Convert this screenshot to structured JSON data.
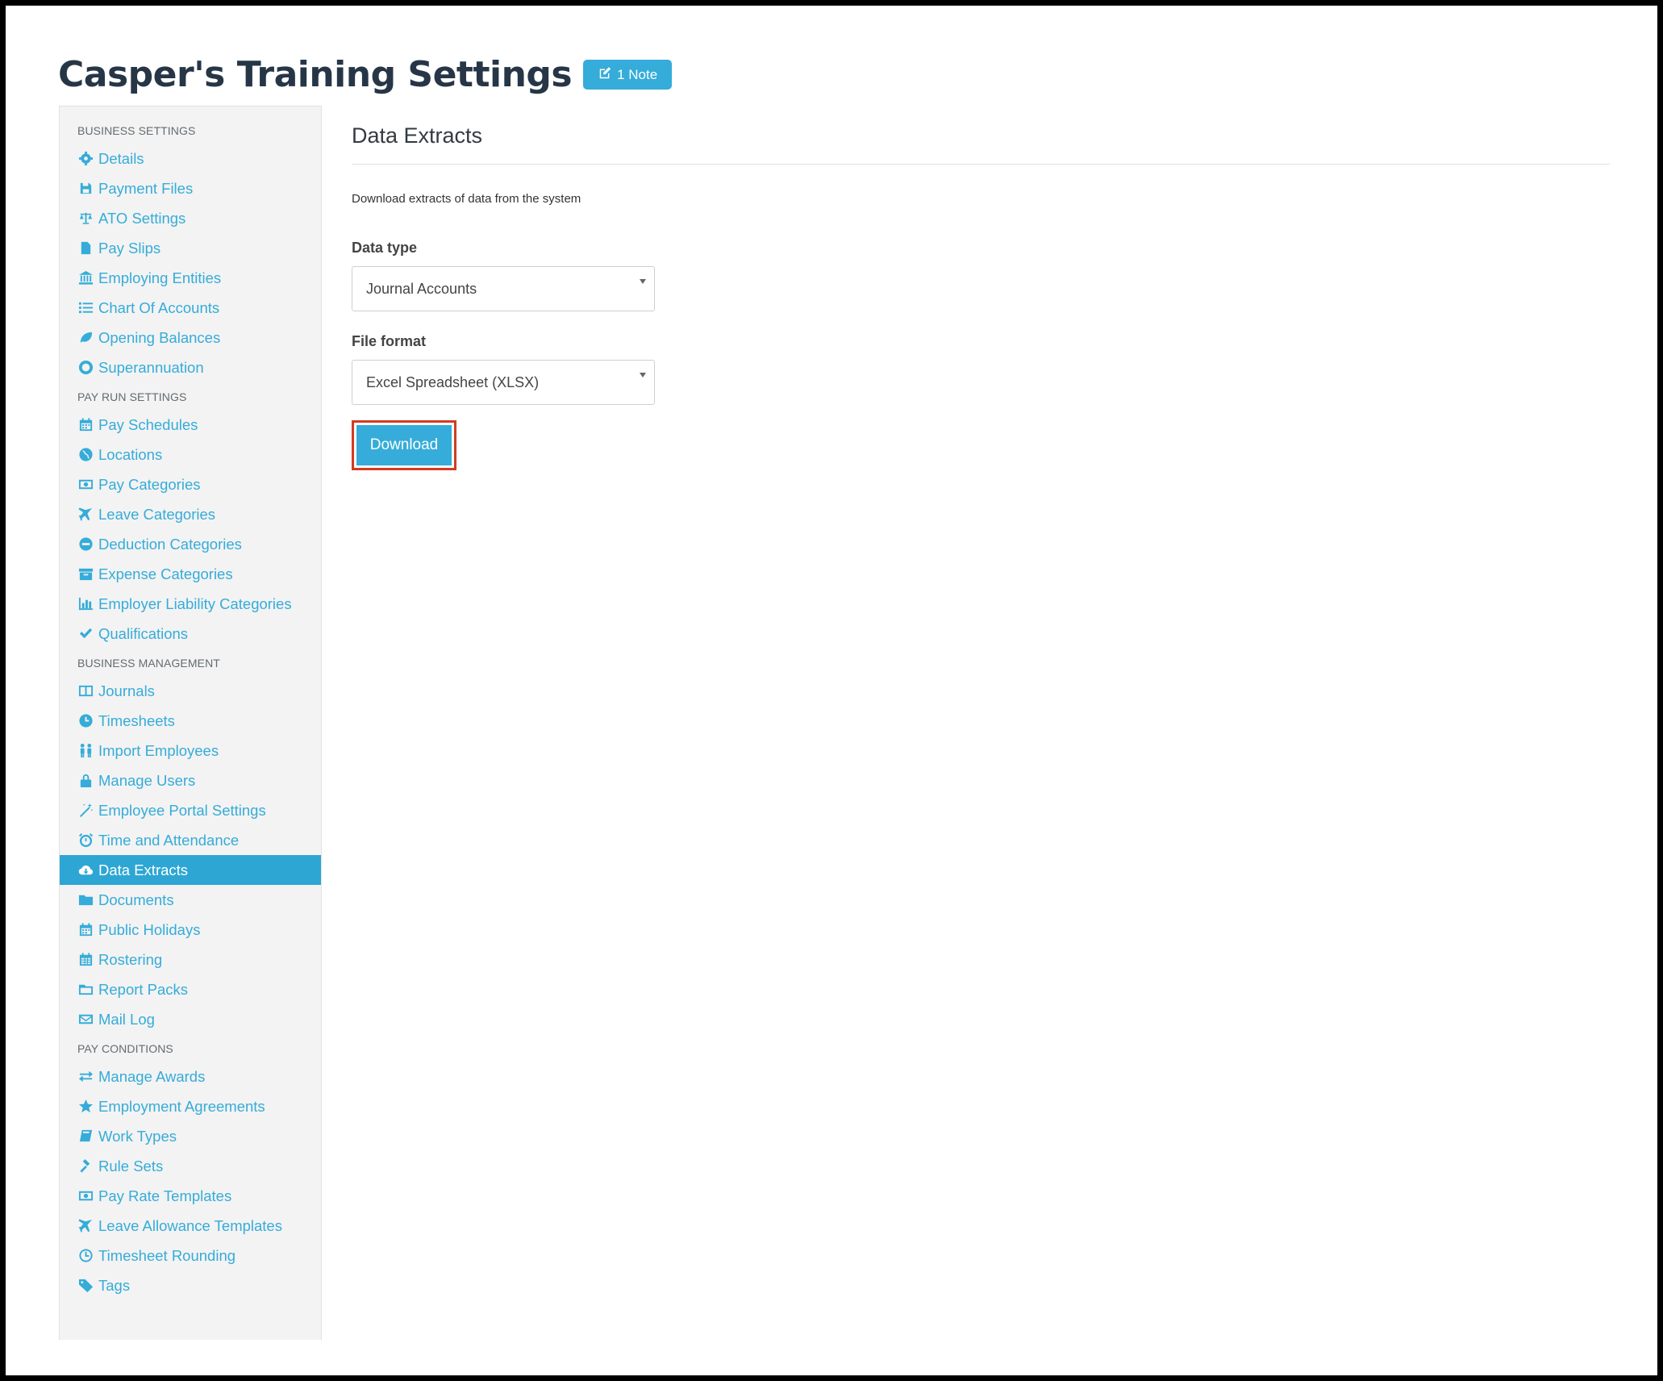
{
  "page": {
    "title": "Casper's Training Settings",
    "note_badge": "1 Note"
  },
  "sidebar": {
    "sections": [
      {
        "header": "BUSINESS SETTINGS",
        "items": [
          {
            "label": "Details",
            "icon": "gear-icon"
          },
          {
            "label": "Payment Files",
            "icon": "floppy-icon"
          },
          {
            "label": "ATO Settings",
            "icon": "scales-icon"
          },
          {
            "label": "Pay Slips",
            "icon": "file-icon"
          },
          {
            "label": "Employing Entities",
            "icon": "bank-icon"
          },
          {
            "label": "Chart Of Accounts",
            "icon": "list-icon"
          },
          {
            "label": "Opening Balances",
            "icon": "leaf-icon"
          },
          {
            "label": "Superannuation",
            "icon": "life-ring-icon"
          }
        ]
      },
      {
        "header": "PAY RUN SETTINGS",
        "items": [
          {
            "label": "Pay Schedules",
            "icon": "calendar-icon"
          },
          {
            "label": "Locations",
            "icon": "globe-icon"
          },
          {
            "label": "Pay Categories",
            "icon": "money-icon"
          },
          {
            "label": "Leave Categories",
            "icon": "plane-icon"
          },
          {
            "label": "Deduction Categories",
            "icon": "minus-circle-icon"
          },
          {
            "label": "Expense Categories",
            "icon": "archive-icon"
          },
          {
            "label": "Employer Liability Categories",
            "icon": "bar-chart-icon"
          },
          {
            "label": "Qualifications",
            "icon": "check-icon"
          }
        ]
      },
      {
        "header": "BUSINESS MANAGEMENT",
        "items": [
          {
            "label": "Journals",
            "icon": "columns-icon"
          },
          {
            "label": "Timesheets",
            "icon": "clock-icon"
          },
          {
            "label": "Import Employees",
            "icon": "users-icon"
          },
          {
            "label": "Manage Users",
            "icon": "lock-icon"
          },
          {
            "label": "Employee Portal Settings",
            "icon": "magic-wand-icon"
          },
          {
            "label": "Time and Attendance",
            "icon": "alarm-icon"
          },
          {
            "label": "Data Extracts",
            "icon": "cloud-download-icon",
            "active": true
          },
          {
            "label": "Documents",
            "icon": "folder-icon"
          },
          {
            "label": "Public Holidays",
            "icon": "calendar-icon"
          },
          {
            "label": "Rostering",
            "icon": "calendar-grid-icon"
          },
          {
            "label": "Report Packs",
            "icon": "folder-open-icon"
          },
          {
            "label": "Mail Log",
            "icon": "envelope-icon"
          }
        ]
      },
      {
        "header": "PAY CONDITIONS",
        "items": [
          {
            "label": "Manage Awards",
            "icon": "exchange-icon"
          },
          {
            "label": "Employment Agreements",
            "icon": "star-icon"
          },
          {
            "label": "Work Types",
            "icon": "book-icon"
          },
          {
            "label": "Rule Sets",
            "icon": "gavel-icon"
          },
          {
            "label": "Pay Rate Templates",
            "icon": "money-icon"
          },
          {
            "label": "Leave Allowance Templates",
            "icon": "plane-icon"
          },
          {
            "label": "Timesheet Rounding",
            "icon": "clock-outline-icon"
          },
          {
            "label": "Tags",
            "icon": "tag-icon"
          }
        ]
      }
    ]
  },
  "main": {
    "title": "Data Extracts",
    "description": "Download extracts of data from the system",
    "data_type": {
      "label": "Data type",
      "value": "Journal Accounts"
    },
    "file_format": {
      "label": "File format",
      "value": "Excel Spreadsheet (XLSX)"
    },
    "download_label": "Download"
  },
  "colors": {
    "accent": "#35acd9",
    "title": "#263647",
    "highlight_border": "#d13d22"
  }
}
